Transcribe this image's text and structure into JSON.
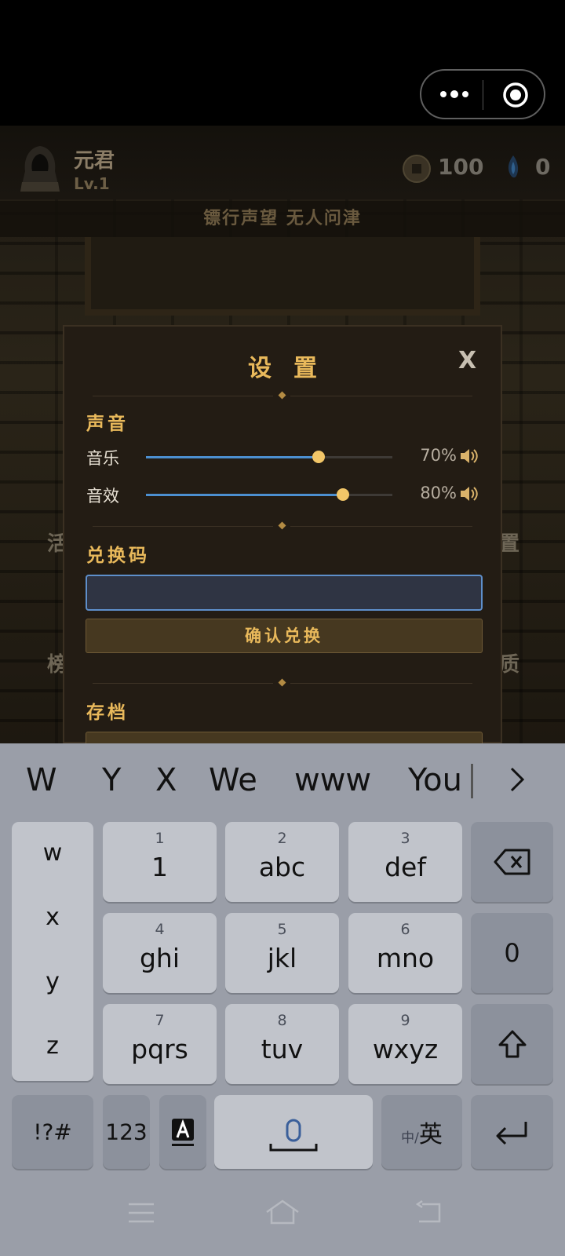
{
  "top_bar": {
    "menu_icon": "more-dots-icon",
    "close_icon": "target-circle-icon"
  },
  "player": {
    "name": "元君",
    "level": "Lv.1",
    "coins": "100",
    "gems": "0"
  },
  "reputation_text": "镖行声望 无人问津",
  "background_labels": {
    "left_1": "活",
    "left_2": "榜",
    "right_1": "置",
    "right_2": "质"
  },
  "settings": {
    "title": "设置",
    "close_label": "X",
    "sound_section": "声音",
    "music_label": "音乐",
    "music_value": 70,
    "music_pct": "70%",
    "sfx_label": "音效",
    "sfx_value": 80,
    "sfx_pct": "80%",
    "redeem_section": "兑换码",
    "redeem_input_value": "",
    "redeem_button": "确认兑换",
    "save_section": "存档"
  },
  "keyboard": {
    "suggestions": [
      "W",
      "Y",
      "X",
      "We",
      "www",
      "You"
    ],
    "side_letters": [
      "w",
      "x",
      "y",
      "z"
    ],
    "keys": [
      {
        "num": "1",
        "main": "1"
      },
      {
        "num": "2",
        "main": "abc"
      },
      {
        "num": "3",
        "main": "def"
      },
      {
        "num": "4",
        "main": "ghi"
      },
      {
        "num": "5",
        "main": "jkl"
      },
      {
        "num": "6",
        "main": "mno"
      },
      {
        "num": "7",
        "main": "pqrs"
      },
      {
        "num": "8",
        "main": "tuv"
      },
      {
        "num": "9",
        "main": "wxyz"
      }
    ],
    "zero": "0",
    "symbols": "!?#",
    "numeric": "123",
    "lang_small": "中/",
    "lang_big": "英"
  },
  "colors": {
    "accent_gold": "#e9b95b",
    "slider_blue": "#4c8fd0",
    "dialog_bg": "#231c14",
    "keyboard_bg": "#9a9ea8"
  }
}
